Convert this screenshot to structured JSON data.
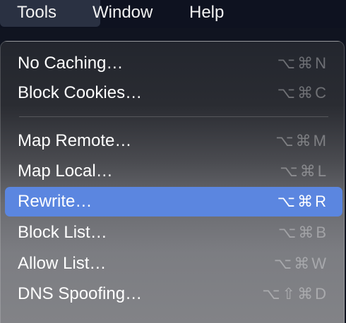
{
  "menubar": {
    "items": [
      {
        "label": "Tools"
      },
      {
        "label": "Window"
      },
      {
        "label": "Help"
      }
    ]
  },
  "menu": {
    "items": [
      {
        "label": "No Caching…",
        "shortcut": "⌥⌘N"
      },
      {
        "label": "Block Cookies…",
        "shortcut": "⌥⌘C"
      },
      {
        "label": "Map Remote…",
        "shortcut": "⌥⌘M"
      },
      {
        "label": "Map Local…",
        "shortcut": "⌥⌘L"
      },
      {
        "label": "Rewrite…",
        "shortcut": "⌥⌘R"
      },
      {
        "label": "Block List…",
        "shortcut": "⌥⌘B"
      },
      {
        "label": "Allow List…",
        "shortcut": "⌥⌘W"
      },
      {
        "label": "DNS Spoofing…",
        "shortcut": "⌥⇧⌘D"
      }
    ],
    "highlighted_item": "Rewrite…"
  },
  "colors": {
    "menubar_bg": "#0e1220",
    "highlight": "#5b86e0",
    "text": "#ffffff"
  }
}
